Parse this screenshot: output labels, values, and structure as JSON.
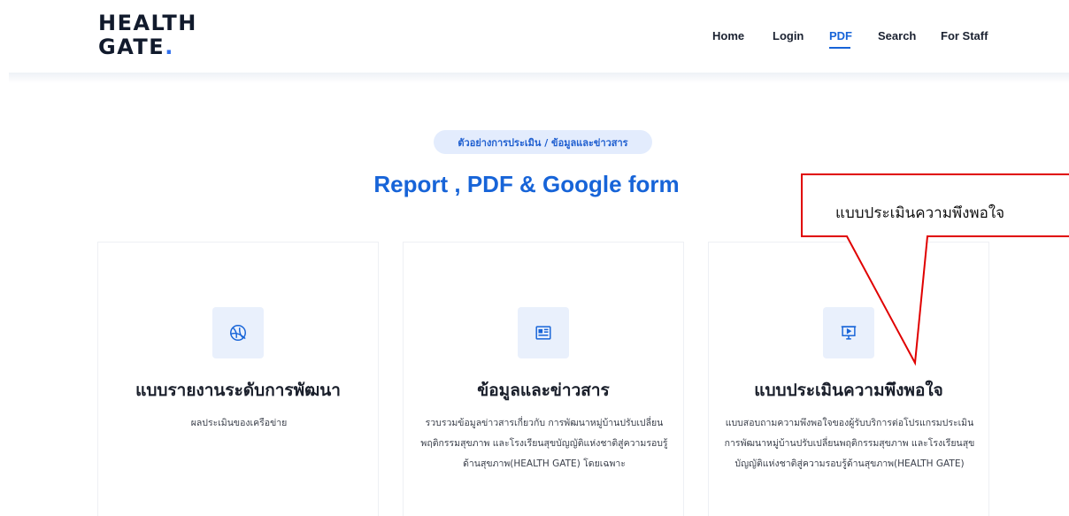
{
  "brand": {
    "line1": "HEALTH",
    "line2": "GATE",
    "dot": "."
  },
  "nav": [
    {
      "label": "Home",
      "active": false
    },
    {
      "label": "Login",
      "active": false
    },
    {
      "label": "PDF",
      "active": true
    },
    {
      "label": "Search",
      "active": false
    },
    {
      "label": "For Staff",
      "active": false
    }
  ],
  "section": {
    "pill": "ตัวอย่างการประเมิน / ข้อมูลและข่าวสาร",
    "title": "Report , PDF & Google form"
  },
  "cards": [
    {
      "icon": "basketball-icon",
      "title": "แบบรายงานระดับการพัฒนา",
      "desc": "ผลประเมินของเครือข่าย"
    },
    {
      "icon": "newspaper-icon",
      "title": "ข้อมูลและข่าวสาร",
      "desc": "รวบรวมข้อมูลข่าวสารเกี่ยวกับ การพัฒนาหมู่บ้านปรับเปลี่ยนพฤติกรรมสุขภาพ และโรงเรียนสุขบัญญัติแห่งชาติสู่ความรอบรู้ด้านสุขภาพ(HEALTH GATE) โดยเฉพาะ"
    },
    {
      "icon": "presentation-icon",
      "title": "แบบประเมินความพึงพอใจ",
      "desc": "แบบสอบถามความพึงพอใจของผู้รับบริการต่อโปรแกรมประเมินการพัฒนาหมู่บ้านปรับเปลี่ยนพฤติกรรมสุขภาพ และโรงเรียนสุขบัญญัติแห่งชาติสู่ความรอบรู้ด้านสุขภาพ(HEALTH GATE)"
    }
  ],
  "callout": {
    "text": "แบบประเมินความพึงพอใจ"
  },
  "colors": {
    "accent": "#1764d8",
    "callout_border": "#e00000"
  }
}
